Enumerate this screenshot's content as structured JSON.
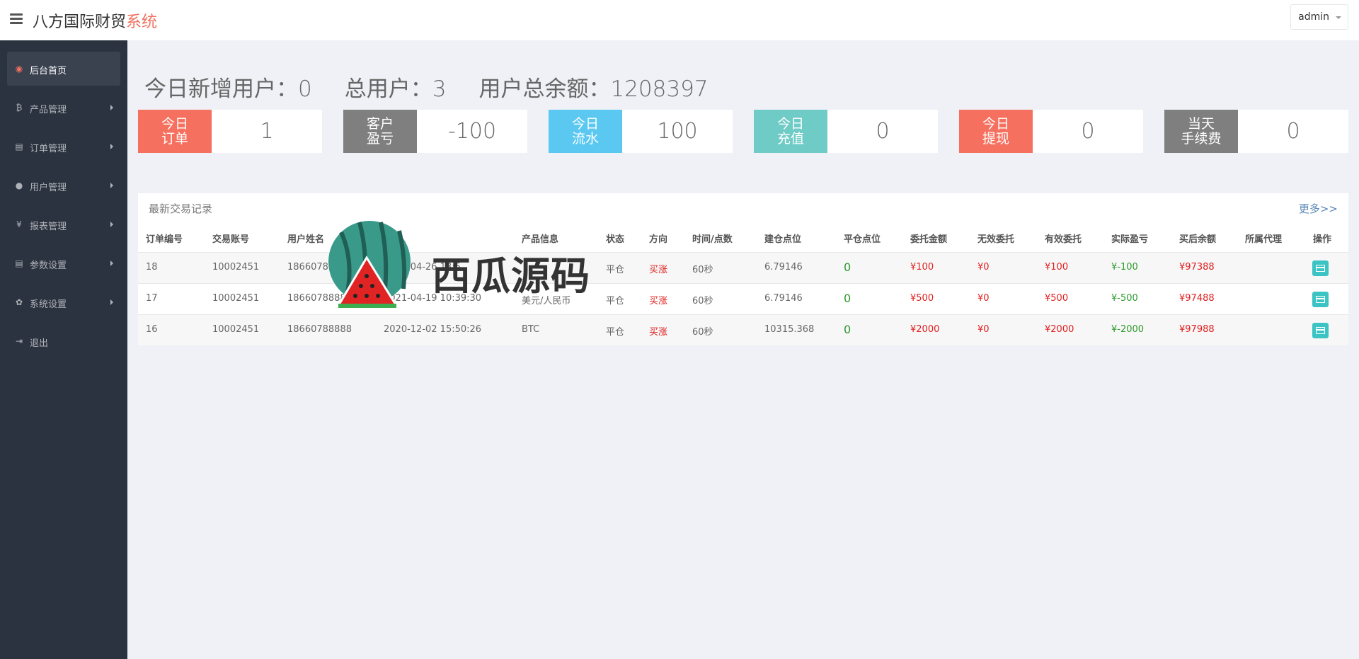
{
  "header": {
    "brand_main": "八方国际财贸",
    "brand_accent": "系统",
    "user": "admin"
  },
  "sidebar": {
    "items": [
      {
        "label": "后台首页",
        "icon": "dashboard-icon",
        "glyph": "◉",
        "active": true
      },
      {
        "label": "产品管理",
        "icon": "bitcoin-icon",
        "glyph": "₿"
      },
      {
        "label": "订单管理",
        "icon": "copy-icon",
        "glyph": "▤"
      },
      {
        "label": "用户管理",
        "icon": "user-icon",
        "glyph": "●"
      },
      {
        "label": "报表管理",
        "icon": "yen-icon",
        "glyph": "¥"
      },
      {
        "label": "参数设置",
        "icon": "copy-icon",
        "glyph": "▤"
      },
      {
        "label": "系统设置",
        "icon": "gears-icon",
        "glyph": "✿"
      },
      {
        "label": "退出",
        "icon": "sign-out-icon",
        "glyph": "⇥"
      }
    ]
  },
  "summary": {
    "new_users": "今日新增用户：0",
    "total_users": "总用户：3",
    "total_balance": "用户总余额：1208397"
  },
  "stats": [
    {
      "label_1": "今日",
      "label_2": "订单",
      "value": "1",
      "color": "#f6705f"
    },
    {
      "label_1": "客户",
      "label_2": "盈亏",
      "value": "-100",
      "color": "#7f7f7f"
    },
    {
      "label_1": "今日",
      "label_2": "流水",
      "value": "100",
      "color": "#5bc8f1"
    },
    {
      "label_1": "今日",
      "label_2": "充值",
      "value": "0",
      "color": "#6fcbc6"
    },
    {
      "label_1": "今日",
      "label_2": "提现",
      "value": "0",
      "color": "#f6705f"
    },
    {
      "label_1": "当天",
      "label_2": "手续费",
      "value": "0",
      "color": "#7f7f7f"
    }
  ],
  "trades": {
    "title": "最新交易记录",
    "more": "更多>>",
    "columns": [
      "订单编号",
      "交易账号",
      "用户姓名",
      "时间",
      "产品信息",
      "状态",
      "方向",
      "时间/点数",
      "建仓点位",
      "平仓点位",
      "委托金额",
      "无效委托",
      "有效委托",
      "实际盈亏",
      "买后余额",
      "所属代理",
      "操作"
    ],
    "rows": [
      {
        "id": "18",
        "account": "10002451",
        "name": "18660788888",
        "time": "2021-04-26 13:5",
        "product": "",
        "status": "平仓",
        "direction": "买涨",
        "period": "60秒",
        "open": "6.79146",
        "close": "0",
        "amount": "¥100",
        "invalid": "¥0",
        "valid": "¥100",
        "pnl": "¥-100",
        "balance": "¥97388",
        "agent": ""
      },
      {
        "id": "17",
        "account": "10002451",
        "name": "18660788888",
        "time": "2021-04-19 10:39:30",
        "product": "美元/人民币",
        "status": "平仓",
        "direction": "买涨",
        "period": "60秒",
        "open": "6.79146",
        "close": "0",
        "amount": "¥500",
        "invalid": "¥0",
        "valid": "¥500",
        "pnl": "¥-500",
        "balance": "¥97488",
        "agent": ""
      },
      {
        "id": "16",
        "account": "10002451",
        "name": "18660788888",
        "time": "2020-12-02 15:50:26",
        "product": "BTC",
        "status": "平仓",
        "direction": "买涨",
        "period": "60秒",
        "open": "10315.368",
        "close": "0",
        "amount": "¥2000",
        "invalid": "¥0",
        "valid": "¥2000",
        "pnl": "¥-2000",
        "balance": "¥97988",
        "agent": ""
      }
    ]
  },
  "watermark": {
    "text": "西瓜源码"
  }
}
